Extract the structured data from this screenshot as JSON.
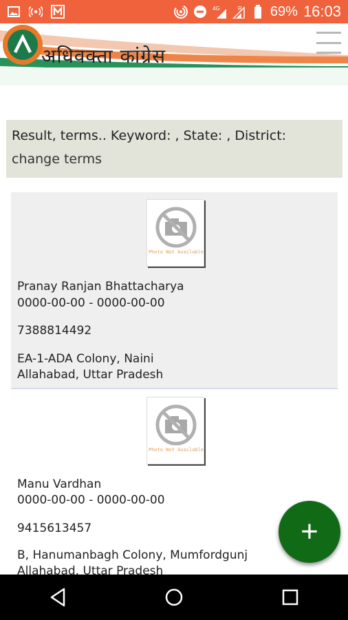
{
  "status_bar": {
    "battery": "69%",
    "time": "16:03",
    "icons": [
      "image-icon",
      "hotspot-icon",
      "m-app-icon",
      "wireless-icon",
      "do-not-disturb-icon",
      "signal-4g-icon",
      "signal-r-icon",
      "battery-icon"
    ]
  },
  "header": {
    "site_title": "अधिवक्ता कांग्रेस",
    "logo_icon": "advocate-congress-logo-icon",
    "menu_icon": "hamburger-menu-icon"
  },
  "search": {
    "summary": "Result, terms.. Keyword: , State: , District:",
    "change_label": "change terms"
  },
  "results": [
    {
      "photo_text": "Photo Not Available",
      "name": "Pranay Ranjan Bhattacharya",
      "dates": "0000-00-00 - 0000-00-00",
      "phone": "7388814492",
      "address_line1": "EA-1-ADA Colony, Naini",
      "address_line2": "Allahabad, Uttar Pradesh"
    },
    {
      "photo_text": "Photo Not Available",
      "name": "Manu Vardhan",
      "dates": "0000-00-00 - 0000-00-00",
      "phone": "9415613457",
      "address_line1": "B, Hanumanbagh Colony, Mumfordgunj",
      "address_line2": "Allahabad, Uttar Pradesh"
    }
  ],
  "fab": {
    "label": "+"
  },
  "colors": {
    "status_bar": "#f0623c",
    "fab": "#116b16",
    "summary_bg": "#e2e3d9",
    "card_bg": "#efefef"
  }
}
